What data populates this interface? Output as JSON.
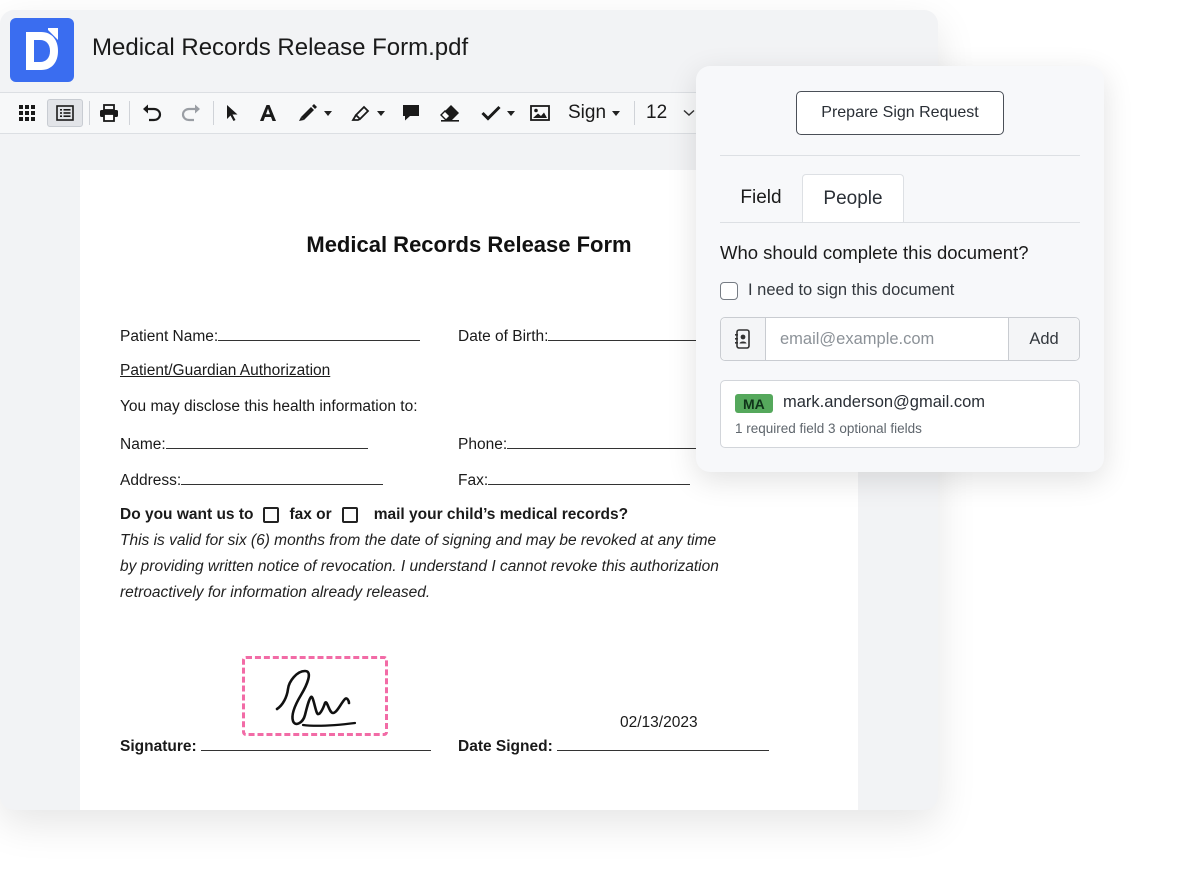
{
  "app": {
    "document_title": "Medical Records Release Form.pdf"
  },
  "toolbar": {
    "sign_label": "Sign",
    "font_size": "12"
  },
  "form": {
    "title": "Medical Records Release Form",
    "patient_name_label": "Patient Name:",
    "dob_label": "Date of Birth:",
    "authorization_heading": "Patient/Guardian Authorization",
    "disclose_label": "You may disclose this health information to:",
    "name_label": "Name:",
    "phone_label": "Phone:",
    "address_label": "Address:",
    "fax_label": "Fax:",
    "question_prefix": "Do you want us to",
    "option_fax": "fax or",
    "option_mail": "mail your child’s medical records?",
    "validity_line1": "This is valid for six (6) months from the date of signing and may be revoked at any time",
    "validity_line2": "by providing written notice of revocation. I understand I cannot revoke this authorization",
    "validity_line3": "retroactively for information already released.",
    "signature_label": "Signature:",
    "date_signed_label": "Date Signed:",
    "date_signed_value": "02/13/2023"
  },
  "panel": {
    "prepare_button": "Prepare Sign Request",
    "tabs": [
      {
        "label": "Field",
        "active": false
      },
      {
        "label": "People",
        "active": true
      }
    ],
    "question": "Who should complete this document?",
    "self_sign_label": "I need to sign this document",
    "self_sign_checked": false,
    "email_placeholder": "email@example.com",
    "add_button": "Add",
    "people": [
      {
        "initials": "MA",
        "email": "mark.anderson@gmail.com",
        "fields_summary": "1 required field 3 optional fields",
        "badge_color": "#55a85c"
      }
    ]
  },
  "colors": {
    "brand": "#3a6df0",
    "signature_box": "#f26ba6"
  }
}
